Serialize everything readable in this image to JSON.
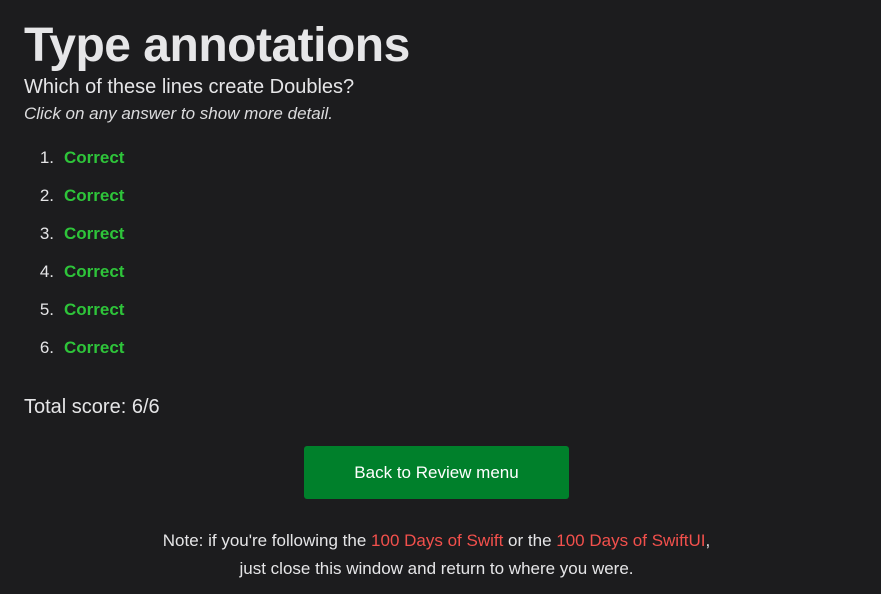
{
  "header": {
    "title": "Type annotations"
  },
  "quiz": {
    "question": "Which of these lines create Doubles?",
    "hint": "Click on any answer to show more detail.",
    "answers": [
      {
        "number": "1.",
        "result": "Correct"
      },
      {
        "number": "2.",
        "result": "Correct"
      },
      {
        "number": "3.",
        "result": "Correct"
      },
      {
        "number": "4.",
        "result": "Correct"
      },
      {
        "number": "5.",
        "result": "Correct"
      },
      {
        "number": "6.",
        "result": "Correct"
      }
    ],
    "total_score": "Total score: 6/6"
  },
  "actions": {
    "back_label": "Back to Review menu"
  },
  "note": {
    "prefix": "Note: if you're following the ",
    "link1": "100 Days of Swift",
    "middle": " or the ",
    "link2": "100 Days of SwiftUI",
    "suffix": ", just close this window and return to where you were."
  },
  "colors": {
    "background": "#1c1c1e",
    "correct": "#2ec43a",
    "button": "#00802b",
    "link": "#f2504c"
  }
}
